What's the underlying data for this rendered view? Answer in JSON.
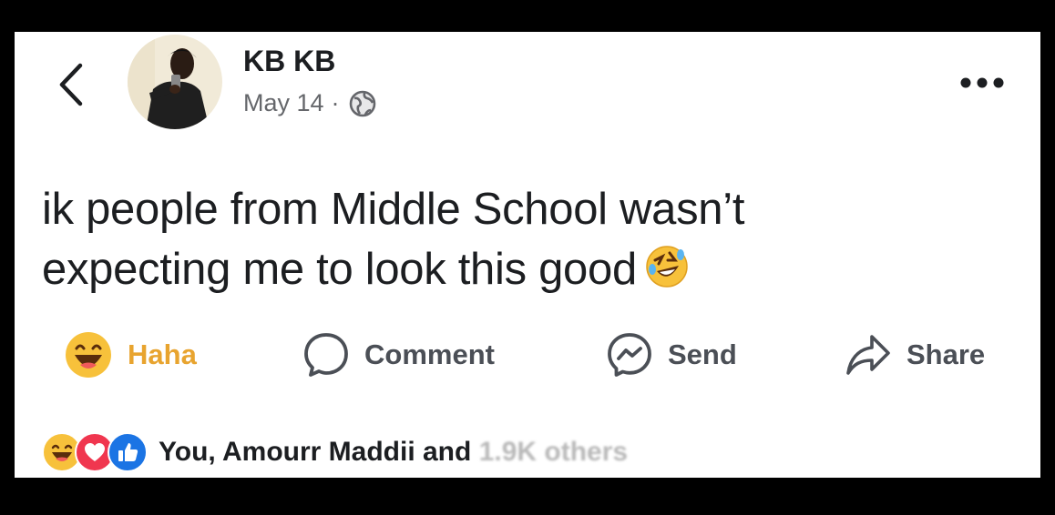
{
  "post": {
    "author": "KB KB",
    "date": "May 14",
    "date_separator": "·",
    "privacy_icon": "globe-icon",
    "text_line1": "ik people from Middle School wasn’t",
    "text_line2": "expecting me to look this good",
    "text_emoji": "rolling-on-floor-laughing-emoji"
  },
  "actions": {
    "haha_label": "Haha",
    "comment_label": "Comment",
    "send_label": "Send",
    "share_label": "Share"
  },
  "reactions": {
    "summary": "You, Amourr Maddii and",
    "others": "1.9K others",
    "icons": [
      "haha-icon",
      "love-icon",
      "like-icon"
    ]
  },
  "colors": {
    "haha_accent": "#e8a42f",
    "love": "#f0364f",
    "like": "#1b74e4",
    "text": "#1c1e21",
    "muted": "#65676b"
  }
}
